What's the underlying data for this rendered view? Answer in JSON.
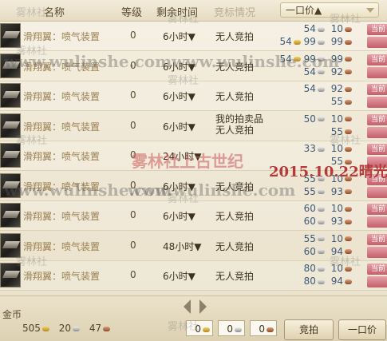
{
  "header": {
    "col_name": "名称",
    "col_level": "等级",
    "col_time": "剩余时间",
    "col_bid_status": "竞标情况",
    "sort_label": "一口价▲"
  },
  "rows": [
    {
      "name": "滑翔翼：喷气装置",
      "level": "0",
      "time": "6小时▼",
      "status": [
        "无人竞拍"
      ],
      "bid": {
        "gold": "",
        "silver": "54",
        "copper": "10"
      },
      "buyout": {
        "gold": "54",
        "silver": "99",
        "copper": "99"
      }
    },
    {
      "name": "滑翔翼：喷气装置",
      "level": "0",
      "time": "6小时▼",
      "status": [
        "无人竞拍"
      ],
      "bid": {
        "gold": "54",
        "silver": "99",
        "copper": "99"
      },
      "buyout": {
        "gold": "",
        "silver": "54",
        "copper": "92"
      }
    },
    {
      "name": "滑翔翼：喷气装置",
      "level": "0",
      "time": "6小时▼",
      "status": [
        "无人竞拍"
      ],
      "bid": {
        "gold": "",
        "silver": "54",
        "copper": "92"
      },
      "buyout": {
        "gold": "",
        "silver": "",
        "copper": "55"
      }
    },
    {
      "name": "滑翔翼：喷气装置",
      "level": "0",
      "time": "6小时▼",
      "status": [
        "我的拍卖品",
        "无人竞拍"
      ],
      "bid": {
        "gold": "",
        "silver": "50",
        "copper": "10"
      },
      "buyout": {
        "gold": "",
        "silver": "",
        "copper": "55"
      }
    },
    {
      "name": "滑翔翼：喷气装置",
      "level": "0",
      "time": "24小时▼",
      "status": [
        ""
      ],
      "bid": {
        "gold": "",
        "silver": "33",
        "copper": "10"
      },
      "buyout": {
        "gold": "",
        "silver": "",
        "copper": "55"
      }
    },
    {
      "name": "滑翔翼：喷气装置",
      "level": "0",
      "time": "6小时▼",
      "status": [
        "无人竞拍"
      ],
      "bid": {
        "gold": "",
        "silver": "55",
        "copper": "10"
      },
      "buyout": {
        "gold": "",
        "silver": "55",
        "copper": "93"
      }
    },
    {
      "name": "滑翔翼：喷气装置",
      "level": "0",
      "time": "6小时▼",
      "status": [
        "无人竞拍"
      ],
      "bid": {
        "gold": "",
        "silver": "60",
        "copper": "10"
      },
      "buyout": {
        "gold": "",
        "silver": "60",
        "copper": "93"
      }
    },
    {
      "name": "滑翔翼：喷气装置",
      "level": "0",
      "time": "48小时▼",
      "status": [
        "无人竞拍"
      ],
      "bid": {
        "gold": "",
        "silver": "55",
        "copper": "10"
      },
      "buyout": {
        "gold": "",
        "silver": "60",
        "copper": "94"
      }
    },
    {
      "name": "滑翔翼：喷气装置",
      "level": "0",
      "time": "6小时▼",
      "status": [
        "无人竞拍"
      ],
      "bid": {
        "gold": "",
        "silver": "80",
        "copper": "10"
      },
      "buyout": {
        "gold": "",
        "silver": "80",
        "copper": "94"
      }
    }
  ],
  "row_button_label": "当前",
  "footer": {
    "coin_label": "金币",
    "wallet": {
      "gold": "505",
      "silver": "20",
      "copper": "47"
    },
    "bid_input": {
      "gold": "0",
      "silver": "0",
      "copper": "0"
    },
    "bid_button": "竞拍",
    "buyout_button": "一口价"
  },
  "watermarks": {
    "site_small": "雾林社",
    "url": "www.wulinshe.com",
    "banner": "雾林社上古世纪",
    "date": "2015.10.22晴光"
  }
}
